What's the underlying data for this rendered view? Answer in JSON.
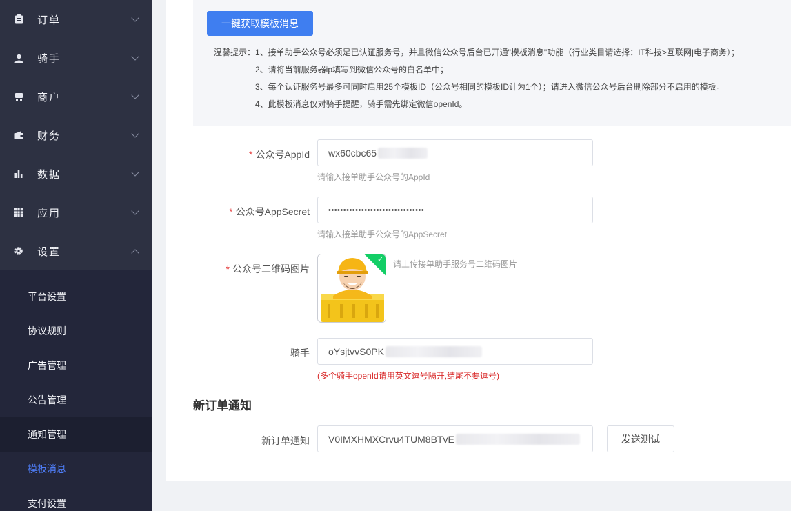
{
  "sidebar": {
    "menu": [
      {
        "label": "订单",
        "icon": "clipboard-icon"
      },
      {
        "label": "骑手",
        "icon": "user-icon"
      },
      {
        "label": "商户",
        "icon": "shop-icon"
      },
      {
        "label": "财务",
        "icon": "wallet-icon"
      },
      {
        "label": "数据",
        "icon": "bar-chart-icon"
      },
      {
        "label": "应用",
        "icon": "grid-icon"
      },
      {
        "label": "设置",
        "icon": "gear-icon"
      }
    ],
    "submenu": [
      {
        "label": "平台设置"
      },
      {
        "label": "协议规则"
      },
      {
        "label": "广告管理"
      },
      {
        "label": "公告管理"
      },
      {
        "label": "通知管理"
      },
      {
        "label": "模板消息"
      },
      {
        "label": "支付设置"
      }
    ]
  },
  "main": {
    "fetch_button": "一键获取模板消息",
    "tips": {
      "line1": "温馨提示：1、接单助手公众号必须是已认证服务号，并且微信公众号后台已开通\"模板消息\"功能（行业类目请选择：IT科技>互联网|电子商务）；",
      "line2": "2、请将当前服务器ip填写到微信公众号的白名单中；",
      "line3": "3、每个认证服务号最多可同时启用25个模板ID（公众号相同的模板ID计为1个）；请进入微信公众号后台删除部分不启用的模板。",
      "line4": "4、此模板消息仅对骑手提醒，骑手需先绑定微信openId。"
    },
    "form": {
      "appid_label": "公众号AppId",
      "appid_value": "wx60cbc65",
      "appid_hint": "请输入接单助手公众号的AppId",
      "secret_label": "公众号AppSecret",
      "secret_value": "••••••••••••••••••••••••••••••••",
      "secret_hint": "请输入接单助手公众号的AppSecret",
      "qrcode_label": "公众号二维码图片",
      "qrcode_hint": "请上传接单助手服务号二维码图片",
      "rider_label": "骑手",
      "rider_value": "oYsjtvvS0PK",
      "rider_hint": "(多个骑手openId请用英文逗号隔开,结尾不要逗号)"
    },
    "new_order": {
      "section_title": "新订单通知",
      "label": "新订单通知",
      "value": "V0IMXHMXCrvu4TUM8BTvE",
      "test_button": "发送测试"
    }
  },
  "colors": {
    "sidebar_bg": "#2d3142",
    "submenu_bg": "#23263a",
    "active_submenu": "#4e7cf5",
    "primary": "#3f7ef0",
    "required": "#e54545",
    "success": "#13ce66"
  }
}
